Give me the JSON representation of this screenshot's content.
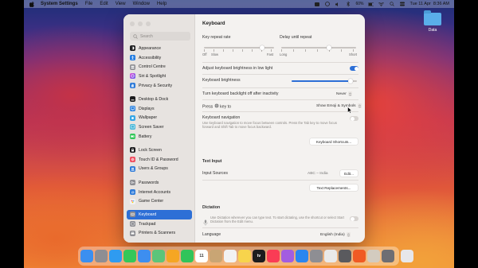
{
  "menubar": {
    "app_name": "System Settings",
    "items": [
      "File",
      "Edit",
      "View",
      "Window",
      "Help"
    ],
    "battery": "60%",
    "datetime": "Tue 11 Apr  8:36 AM"
  },
  "desktop": {
    "folder_label": "Data"
  },
  "sidebar": {
    "search_placeholder": "Search",
    "groups": [
      [
        {
          "label": "Appearance",
          "icon": "appearance-icon",
          "color": "#1c1c1e"
        },
        {
          "label": "Accessibility",
          "icon": "accessibility-icon",
          "color": "#1f7ae0"
        },
        {
          "label": "Control Centre",
          "icon": "control-centre-icon",
          "color": "#8e8e93"
        },
        {
          "label": "Siri & Spotlight",
          "icon": "siri-icon",
          "color": "#b04ad8"
        },
        {
          "label": "Privacy & Security",
          "icon": "hand-icon",
          "color": "#2e7bd9"
        }
      ],
      [
        {
          "label": "Desktop & Dock",
          "icon": "dock-icon",
          "color": "#1c1c1e"
        },
        {
          "label": "Displays",
          "icon": "display-icon",
          "color": "#2d83e0"
        },
        {
          "label": "Wallpaper",
          "icon": "wallpaper-icon",
          "color": "#37a6e6"
        },
        {
          "label": "Screen Saver",
          "icon": "screen-saver-icon",
          "color": "#48b7d9"
        },
        {
          "label": "Battery",
          "icon": "battery-icon",
          "color": "#34c759"
        }
      ],
      [
        {
          "label": "Lock Screen",
          "icon": "lock-screen-icon",
          "color": "#1c1c1e"
        },
        {
          "label": "Touch ID & Password",
          "icon": "fingerprint-icon",
          "color": "#ef4d5f"
        },
        {
          "label": "Users & Groups",
          "icon": "users-icon",
          "color": "#2e7bd9"
        }
      ],
      [
        {
          "label": "Passwords",
          "icon": "key-icon",
          "color": "#8e8e93"
        },
        {
          "label": "Internet Accounts",
          "icon": "at-icon",
          "color": "#2e7bd9"
        },
        {
          "label": "Game Center",
          "icon": "game-center-icon",
          "color": "#e5e5ea"
        }
      ],
      [
        {
          "label": "Keyboard",
          "icon": "keyboard-icon",
          "color": "#8e8e93",
          "selected": true
        },
        {
          "label": "Trackpad",
          "icon": "trackpad-icon",
          "color": "#8e8e93"
        },
        {
          "label": "Printers & Scanners",
          "icon": "printer-icon",
          "color": "#8e8e93"
        }
      ]
    ]
  },
  "content": {
    "title": "Keyboard",
    "key_repeat_rate": "Key repeat rate",
    "delay_until_repeat": "Delay until repeat",
    "repeat_off": "Off",
    "repeat_slow": "Slow",
    "repeat_fast": "Fast",
    "delay_long": "Long",
    "delay_short": "Short",
    "adjust_brightness": "Adjust keyboard brightness in low light",
    "keyboard_brightness": "Keyboard brightness",
    "keyboard_brightness_level": 0.9,
    "backlight_off": "Turn keyboard backlight off after inactivity",
    "backlight_off_value": "Never",
    "press_key_prefix": "Press",
    "press_key_suffix": "key to",
    "press_key_value": "Show Emoji & Symbols",
    "keyboard_navigation": "Keyboard navigation",
    "keyboard_navigation_desc": "Use keyboard navigation to move focus between controls. Press the Tab key to move focus forward and Shift Tab to move focus backward.",
    "keyboard_shortcuts_button": "Keyboard Shortcuts...",
    "text_input_title": "Text Input",
    "input_sources": "Input Sources",
    "input_sources_value": "ABC – India",
    "edit_button": "Edit...",
    "text_replacements_button": "Text Replacements...",
    "dictation_title": "Dictation",
    "dictation_desc": "Use Dictation wherever you can type text. To start dictating, use the shortcut or select Start Dictation from the Edit menu.",
    "language": "Language",
    "language_value": "English (India)"
  },
  "dock": {
    "apps": [
      {
        "name": "finder-icon",
        "color": "#3b8ff0"
      },
      {
        "name": "launchpad-icon",
        "color": "#8e8e93"
      },
      {
        "name": "safari-icon",
        "color": "#2f9bf0"
      },
      {
        "name": "messages-icon",
        "color": "#34c759"
      },
      {
        "name": "mail-icon",
        "color": "#3d8ef0"
      },
      {
        "name": "maps-icon",
        "color": "#5cc47a"
      },
      {
        "name": "photos-icon",
        "color": "#f5a623"
      },
      {
        "name": "facetime-icon",
        "color": "#31c45a"
      },
      {
        "name": "calendar-icon",
        "color": "#ffffff",
        "text": "11"
      },
      {
        "name": "contacts-icon",
        "color": "#c9a574"
      },
      {
        "name": "reminders-icon",
        "color": "#f2f2f2"
      },
      {
        "name": "notes-icon",
        "color": "#f7d44c"
      },
      {
        "name": "tv-icon",
        "color": "#1c1c1e",
        "text": "tv"
      },
      {
        "name": "music-icon",
        "color": "#fa3c55"
      },
      {
        "name": "podcasts-icon",
        "color": "#a35de0"
      },
      {
        "name": "app-store-icon",
        "color": "#2a86f0"
      },
      {
        "name": "system-settings-icon",
        "color": "#8e8e93"
      },
      {
        "name": "chrome-icon",
        "color": "#e9e9e9"
      },
      {
        "name": "screenshot-icon",
        "color": "#5a5a5e"
      },
      {
        "name": "brave-icon",
        "color": "#f05a24"
      },
      {
        "name": "preview-icon",
        "color": "#d3cbbf"
      },
      {
        "name": "settings-gear-icon",
        "color": "#6e6e73"
      },
      {
        "name": "trash-icon",
        "color": "#e7e7ea"
      }
    ]
  },
  "colors": {
    "accent": "#2d6fd6"
  }
}
